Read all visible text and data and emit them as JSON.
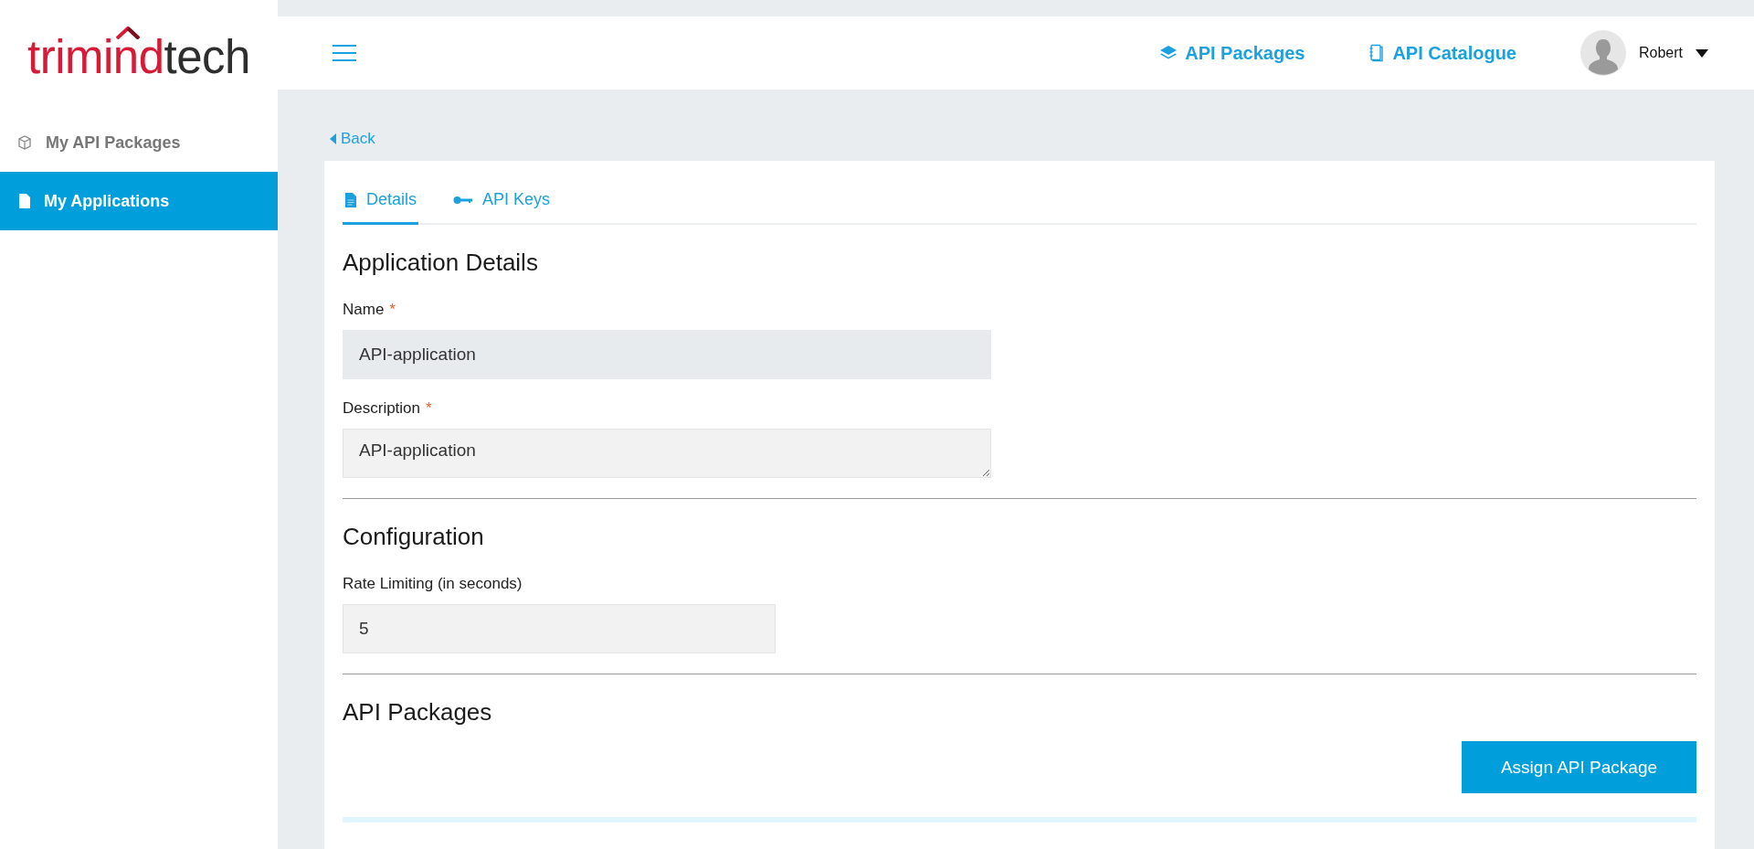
{
  "logo": {
    "first_part": "trimind",
    "second_part": "tech"
  },
  "sidebar": {
    "items": [
      {
        "label": "My API Packages",
        "selected": false
      },
      {
        "label": "My Applications",
        "selected": true
      }
    ]
  },
  "topbar": {
    "nav_links": [
      {
        "label": "API Packages"
      },
      {
        "label": "API Catalogue"
      }
    ],
    "user": {
      "name": "Robert"
    }
  },
  "back_link": "Back",
  "tabs": [
    {
      "label": "Details",
      "selected": true
    },
    {
      "label": "API Keys",
      "selected": false
    }
  ],
  "sections": [
    {
      "heading": "Application Details",
      "fields": [
        {
          "label": "Name",
          "required_mark": "*",
          "kind": "locked",
          "value": "API-application"
        },
        {
          "label": "Description",
          "required_mark": "*",
          "kind": "textarea",
          "value": "API-application"
        }
      ]
    },
    {
      "heading": "Configuration",
      "fields": [
        {
          "label": "Rate Limiting (in seconds)",
          "kind": "input",
          "value": "5"
        }
      ]
    },
    {
      "heading": "API Packages",
      "button": "Assign API Package"
    }
  ]
}
